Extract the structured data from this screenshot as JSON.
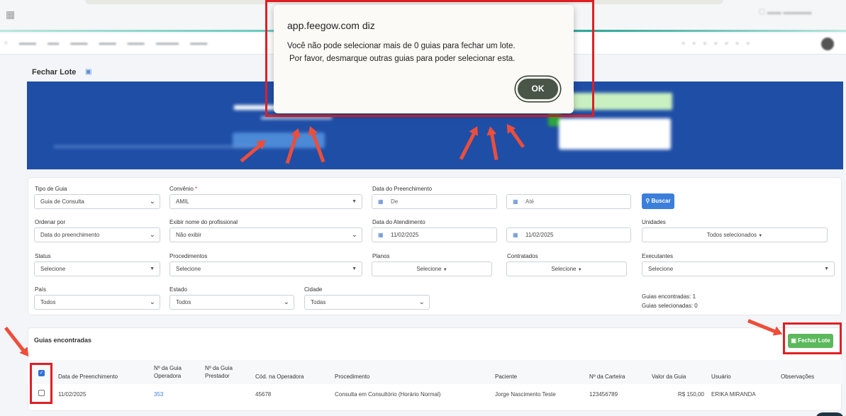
{
  "dialog": {
    "title": "app.feegow.com diz",
    "message_line1": "Você não pode selecionar mais de 0 guias para fechar um lote.",
    "message_line2": "Por favor, desmarque outras guias para poder selecionar esta.",
    "ok_label": "OK"
  },
  "page": {
    "title": "Fechar Lote"
  },
  "filters": {
    "tipo_guia": {
      "label": "Tipo de Guia",
      "value": "Guia de Consulta"
    },
    "convenio": {
      "label": "Convênio",
      "required": "*",
      "value": "AMIL"
    },
    "data_preenchimento": {
      "label": "Data do Preenchimento",
      "from_placeholder": "De",
      "to_placeholder": "Até"
    },
    "buscar_label": "Buscar",
    "ordenar_por": {
      "label": "Ordenar por",
      "value": "Data do preenchimento"
    },
    "exibir_nome": {
      "label": "Exibir nome do profissional",
      "value": "Não exibir"
    },
    "data_atendimento": {
      "label": "Data do Atendimento",
      "from": "11/02/2025",
      "to": "11/02/2025"
    },
    "unidades": {
      "label": "Unidades",
      "value": "Todos selecionados"
    },
    "status": {
      "label": "Status",
      "value": "Selecione"
    },
    "procedimentos": {
      "label": "Procedimentos",
      "value": "Selecione"
    },
    "planos": {
      "label": "Planos",
      "value": "Selecione"
    },
    "contratados": {
      "label": "Contratados",
      "value": "Selecione"
    },
    "executantes": {
      "label": "Executantes",
      "value": "Selecione"
    },
    "pais": {
      "label": "País",
      "value": "Todos"
    },
    "estado": {
      "label": "Estado",
      "value": "Todos"
    },
    "cidade": {
      "label": "Cidade",
      "value": "Todas"
    },
    "guias_encontradas": "Guias encontradas: 1",
    "guias_selecionadas": "Guias selecionadas: 0"
  },
  "list": {
    "title": "Guias encontradas",
    "fechar_lote_label": "Fechar Lote",
    "headers": {
      "data": "Data de Preenchimento",
      "guia_operadora_1": "Nº da Guia",
      "guia_operadora_2": "Operadora",
      "guia_prestador_1": "Nº da Guia",
      "guia_prestador_2": "Prestador",
      "cod_operadora": "Cód. na Operadora",
      "procedimento": "Procedimento",
      "paciente": "Paciente",
      "carteira": "Nº da Carteira",
      "valor": "Valor da Guia",
      "usuario": "Usuário",
      "observacoes": "Observações"
    },
    "rows": [
      {
        "data": "11/02/2025",
        "guia_operadora": "353",
        "cod_operadora": "45678",
        "procedimento": "Consulta em Consultório (Horário Normal)",
        "paciente": "Jorge Nascimento Teste",
        "carteira": "123456789",
        "valor": "R$ 150,00",
        "usuario": "ERIKA MIRANDA"
      }
    ]
  },
  "colors": {
    "accent": "#3b7fdb",
    "success": "#5cb85c",
    "highlight": "#e01f24",
    "banner": "#1f4ea6"
  }
}
